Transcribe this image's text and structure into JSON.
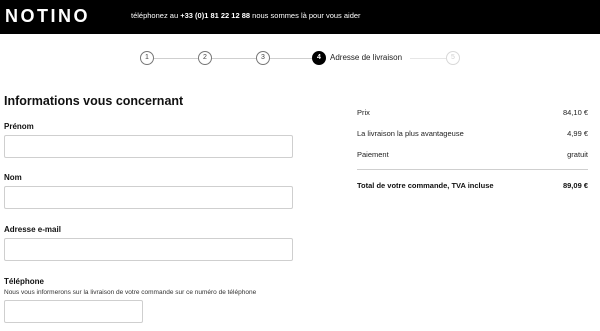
{
  "header": {
    "logo": "NOTINO",
    "contact_prefix": "téléphonez au",
    "phone": "+33 (0)1 81 22 12 88",
    "contact_suffix": "nous sommes là pour vous aider"
  },
  "stepper": {
    "steps": [
      {
        "number": "1",
        "state": "done"
      },
      {
        "number": "2",
        "state": "done"
      },
      {
        "number": "3",
        "state": "done"
      },
      {
        "number": "4",
        "state": "active",
        "label": "Adresse de livraison"
      },
      {
        "number": "5",
        "state": "disabled"
      }
    ]
  },
  "form": {
    "title": "Informations vous concernant",
    "first_name_label": "Prénom",
    "first_name_value": "",
    "last_name_label": "Nom",
    "last_name_value": "",
    "email_label": "Adresse e-mail",
    "email_value": "",
    "phone_label": "Téléphone",
    "phone_hint": "Nous vous informerons sur la livraison de votre commande sur ce numéro de téléphone",
    "phone_value": ""
  },
  "summary": {
    "price_label": "Prix",
    "price_value": "84,10 €",
    "delivery_label": "La livraison la plus avantageuse",
    "delivery_value": "4,99 €",
    "payment_label": "Paiement",
    "payment_value": "gratuit",
    "total_label": "Total de votre commande, TVA incluse",
    "total_value": "89,09 €"
  },
  "colors": {
    "header_bg": "#000000",
    "active_step": "#000000",
    "border": "#cfcfcf"
  }
}
